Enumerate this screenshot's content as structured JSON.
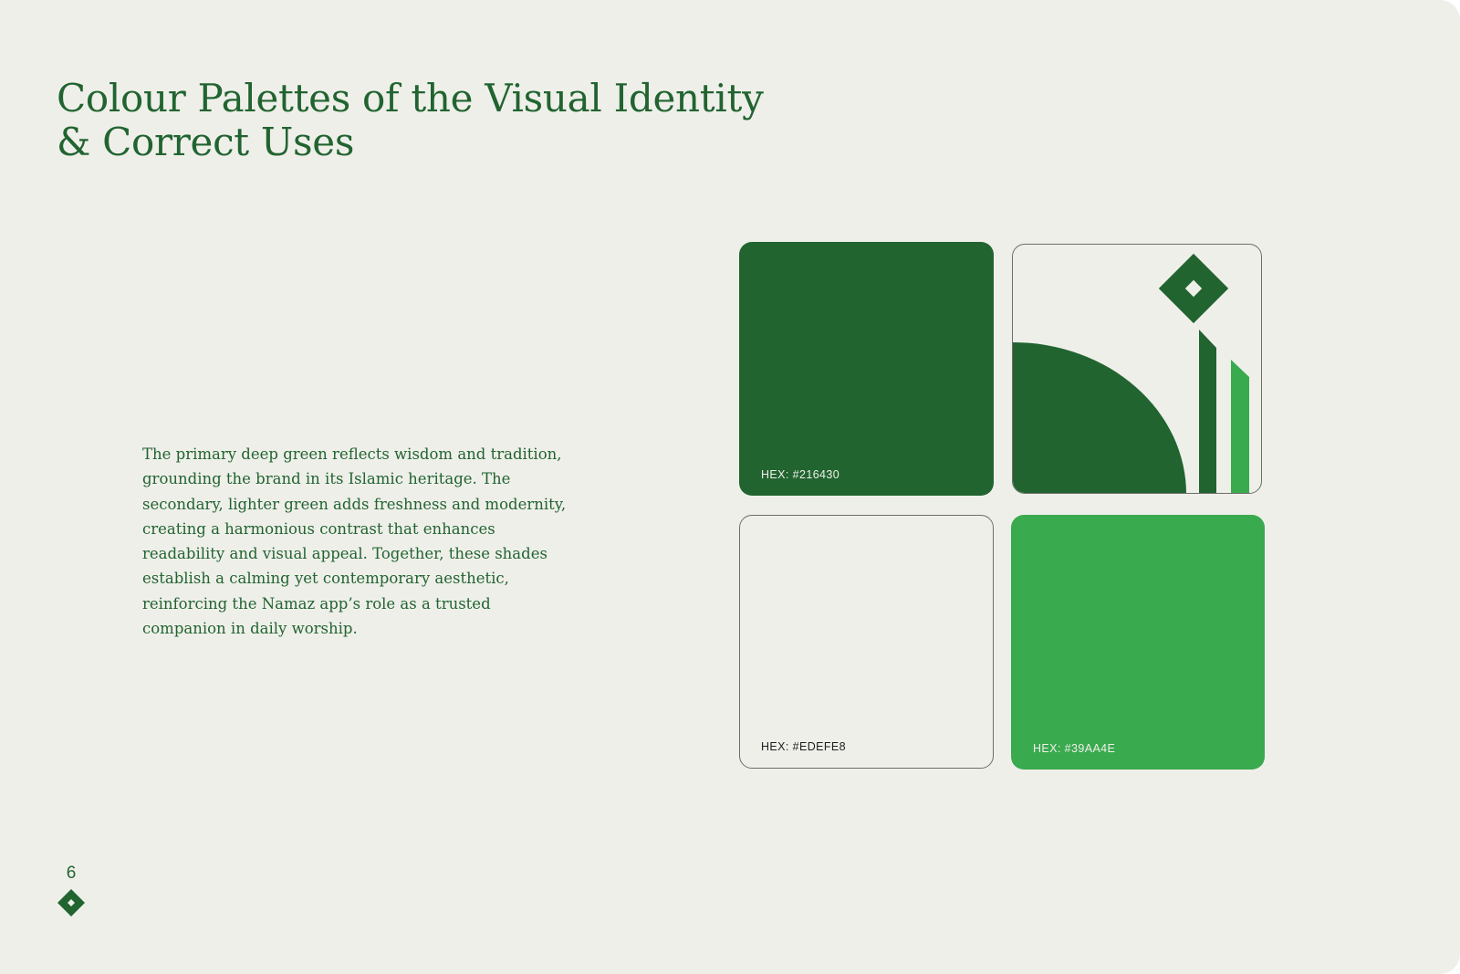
{
  "title": {
    "line1": "Colour Palettes of the Visual Identity",
    "line2": "& Correct Uses"
  },
  "description": "The primary deep green reflects wisdom and tradition, grounding the brand in its Islamic heritage. The secondary, lighter green adds freshness and modernity, creating a harmonious contrast that enhances readability and visual appeal. Together, these shades establish a calming yet contemporary aesthetic, reinforcing the Namaz app’s role as a trusted companion in daily worship.",
  "swatches": [
    {
      "label": "HEX: #216430",
      "color": "#216430"
    },
    {
      "label": "HEX: #EDEFE8",
      "color": "#EDEFE8"
    },
    {
      "label": "HEX: #39AA4E",
      "color": "#39AA4E"
    }
  ],
  "logo_icon": "namaz-mosque-mark-icon",
  "footer": {
    "page_number": "6",
    "page_icon": "diamond-icon"
  }
}
